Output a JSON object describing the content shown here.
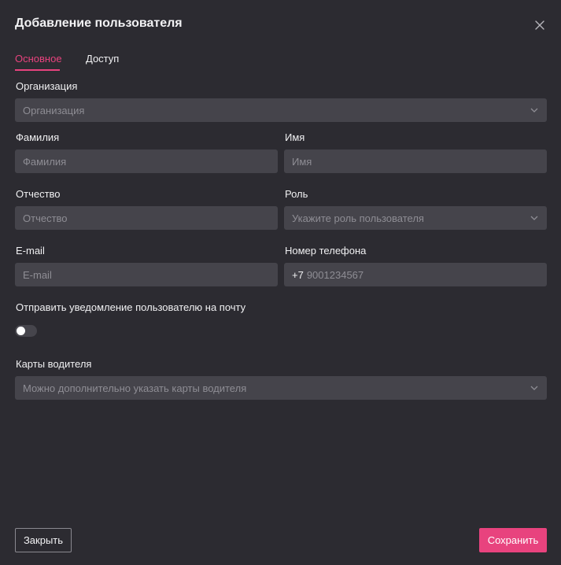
{
  "dialog": {
    "title": "Добавление пользователя"
  },
  "tabs": [
    {
      "label": "Основное",
      "active": true
    },
    {
      "label": "Доступ",
      "active": false
    }
  ],
  "form": {
    "organization": {
      "label": "Организация",
      "placeholder": "Организация"
    },
    "last_name": {
      "label": "Фамилия",
      "placeholder": "Фамилия"
    },
    "first_name": {
      "label": "Имя",
      "placeholder": "Имя"
    },
    "middle_name": {
      "label": "Отчество",
      "placeholder": "Отчество"
    },
    "role": {
      "label": "Роль",
      "placeholder": "Укажите роль пользователя"
    },
    "email": {
      "label": "E-mail",
      "placeholder": "E-mail"
    },
    "phone": {
      "label": "Номер телефона",
      "prefix": "+7",
      "placeholder": "9001234567"
    },
    "notify": {
      "label": "Отправить уведомление пользователю на почту",
      "enabled": false
    },
    "driver_cards": {
      "label": "Карты водителя",
      "placeholder": "Можно дополнительно указать карты водителя"
    }
  },
  "buttons": {
    "close_label": "Закрыть",
    "save_label": "Сохранить"
  },
  "colors": {
    "background": "#2c2b31",
    "field": "#45444b",
    "accent": "#e8437e",
    "text": "#f0f0f2",
    "placeholder": "#8e8d94"
  },
  "icons": {
    "close": "close-icon",
    "dropdown": "chevron-down-icon"
  }
}
